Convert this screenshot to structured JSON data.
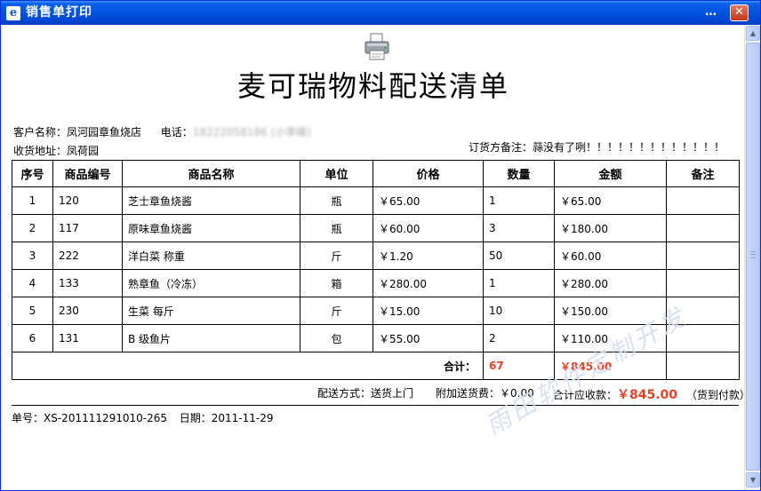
{
  "window": {
    "title": "销售单打印",
    "icon_label": "e",
    "minimize_glyph": "…",
    "close_glyph": "✕"
  },
  "document": {
    "title": "麦可瑞物料配送清单",
    "customer_label": "客户名称：",
    "customer_name": "凤河园章鱼烧店",
    "phone_label": "电话：",
    "phone_value": "18222058186 (小李峰)",
    "address_label": "收货地址：",
    "address_value": "凤荷园",
    "note_label": "订货方备注：",
    "note_value": "蒜没有了咧！！！！！！！！！！！！！"
  },
  "table": {
    "headers": [
      "序号",
      "商品编号",
      "商品名称",
      "单位",
      "价格",
      "数量",
      "金额",
      "备注"
    ],
    "rows": [
      {
        "no": "1",
        "code": "120",
        "name": "芝士章鱼烧酱",
        "unit": "瓶",
        "price": "￥65.00",
        "qty": "1",
        "amount": "￥65.00",
        "remark": ""
      },
      {
        "no": "2",
        "code": "117",
        "name": "原味章鱼烧酱",
        "unit": "瓶",
        "price": "￥60.00",
        "qty": "3",
        "amount": "￥180.00",
        "remark": ""
      },
      {
        "no": "3",
        "code": "222",
        "name": "洋白菜 称重",
        "unit": "斤",
        "price": "￥1.20",
        "qty": "50",
        "amount": "￥60.00",
        "remark": ""
      },
      {
        "no": "4",
        "code": "133",
        "name": "熟章鱼（冷冻）",
        "unit": "箱",
        "price": "￥280.00",
        "qty": "1",
        "amount": "￥280.00",
        "remark": ""
      },
      {
        "no": "5",
        "code": "230",
        "name": "生菜 每斤",
        "unit": "斤",
        "price": "￥15.00",
        "qty": "10",
        "amount": "￥150.00",
        "remark": ""
      },
      {
        "no": "6",
        "code": "131",
        "name": "B 级鱼片",
        "unit": "包",
        "price": "￥55.00",
        "qty": "2",
        "amount": "￥110.00",
        "remark": ""
      }
    ],
    "total_label": "合计：",
    "total_qty": "67",
    "total_amount": "￥845.00"
  },
  "summary": {
    "delivery_label": "配送方式：",
    "delivery_value": "送货上门",
    "extra_fee_label": "附加送货费：",
    "extra_fee_value": "￥0.00",
    "grand_total_label": "合计应收款：",
    "grand_total_value": "￥845.00",
    "payment_note": "（货到付款）"
  },
  "footer": {
    "order_no_label": "单号：",
    "order_no_value": "XS-201111291010-265",
    "date_label": "日期：",
    "date_value": "2011-11-29"
  },
  "watermark": "雨田软件定制开发",
  "colors": {
    "titlebar": "#0053e0",
    "accent_red": "#e8412a",
    "watermark": "#d5def0"
  }
}
